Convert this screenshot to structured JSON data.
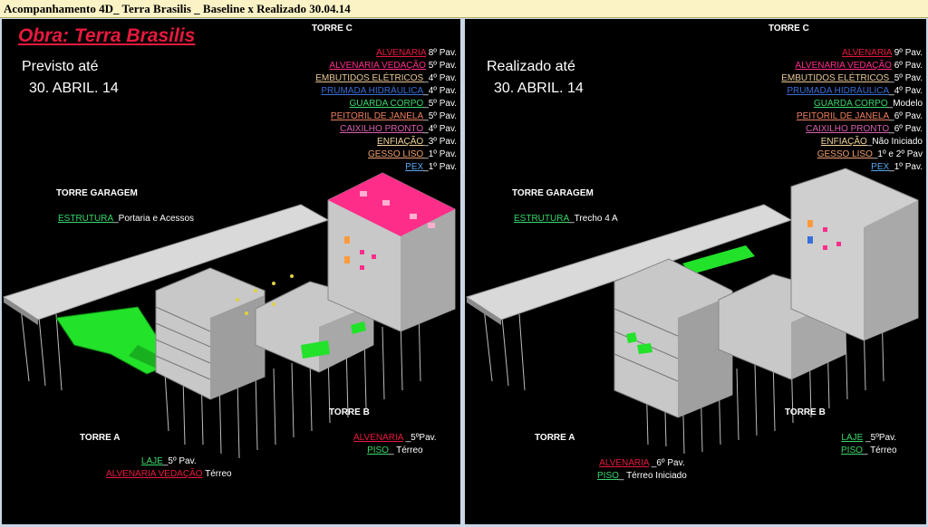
{
  "title": "Acompanhamento 4D_ Terra Brasilis _ Baseline x Realizado 30.04.14",
  "colors": {
    "red": "#e8193e",
    "magenta": "#ff2d8a",
    "blue": "#3a6fd8",
    "green": "#39d86a",
    "salmon": "#f08060",
    "pink": "#d95fb0",
    "cream": "#f2d49a",
    "peach": "#f0a070",
    "lightblue": "#58a8f0",
    "tan": "#e8c898",
    "white": "#ffffff"
  },
  "left": {
    "obra": "Obra: Terra Brasilis",
    "label_line1": "Previsto até",
    "label_line2": "30. ABRIL. 14",
    "torre_c": "TORRE C",
    "torre_garagem": "TORRE GARAGEM",
    "garagem_item": {
      "key": "ESTRUTURA",
      "value": "_Portaria e Acessos"
    },
    "torre_a": "TORRE A",
    "torre_b": "TORRE B",
    "torre_c_items": [
      {
        "key": "ALVENARIA",
        "value": "8º Pav.",
        "color": "red"
      },
      {
        "key": "ALVENARIA VEDAÇÃO",
        "value": "5º Pav.",
        "color": "magenta"
      },
      {
        "key": "EMBUTIDOS ELÉTRICOS",
        "value": "_4º Pav.",
        "color": "tan"
      },
      {
        "key": "PRUMADA HIDRÁULICA",
        "value": "_4º Pav.",
        "color": "blue"
      },
      {
        "key": "GUARDA CORPO",
        "value": "_5º Pav.",
        "color": "green"
      },
      {
        "key": "PEITORIL DE JANELA",
        "value": "_5º Pav.",
        "color": "salmon"
      },
      {
        "key": "CAIXILHO PRONTO",
        "value": "_4º Pav.",
        "color": "pink"
      },
      {
        "key": "ENFIAÇÃO",
        "value": "_3º Pav.",
        "color": "cream"
      },
      {
        "key": "GESSO LISO",
        "value": "_1º Pav.",
        "color": "peach"
      },
      {
        "key": "PEX",
        "value": "_1º Pav.",
        "color": "lightblue"
      }
    ],
    "torre_a_items": [
      {
        "key": "LAJE",
        "value": "_5º Pav.",
        "color": "green"
      },
      {
        "key": "ALVENARIA VEDAÇÃO",
        "value": " Térreo",
        "color": "red"
      }
    ],
    "torre_b_items": [
      {
        "key": "ALVENARIA",
        "value": " _5ºPav.",
        "color": "red"
      },
      {
        "key": "PISO",
        "value": "_ Térreo",
        "color": "green"
      }
    ]
  },
  "right": {
    "label_line1": "Realizado até",
    "label_line2": "30. ABRIL. 14",
    "torre_c": "TORRE C",
    "torre_garagem": "TORRE GARAGEM",
    "garagem_item": {
      "key": "ESTRUTURA",
      "value": "_Trecho  4 A"
    },
    "torre_a": "TORRE A",
    "torre_b": "TORRE B",
    "torre_c_items": [
      {
        "key": "ALVENARIA",
        "value": "9º Pav.",
        "color": "red"
      },
      {
        "key": "ALVENARIA VEDAÇÃO",
        "value": "6º Pav.",
        "color": "magenta"
      },
      {
        "key": "EMBUTIDOS ELÉTRICOS",
        "value": "_5º Pav.",
        "color": "tan"
      },
      {
        "key": "PRUMADA HIDRÁULICA",
        "value": "_4º Pav.",
        "color": "blue"
      },
      {
        "key": "GUARDA CORPO",
        "value": "_Modelo",
        "color": "green"
      },
      {
        "key": "PEITORIL DE JANELA",
        "value": "_6º Pav.",
        "color": "salmon"
      },
      {
        "key": "CAIXILHO PRONTO",
        "value": "_6º Pav.",
        "color": "pink"
      },
      {
        "key": "ENFIAÇÃO",
        "value": "_Não Iniciado",
        "color": "cream"
      },
      {
        "key": "GESSO LISO",
        "value": "_1º  e 2º Pav",
        "color": "peach"
      },
      {
        "key": "PEX",
        "value": "_1º Pav.",
        "color": "lightblue"
      }
    ],
    "torre_a_items": [
      {
        "key": "ALVENARIA",
        "value": " _6º Pav.",
        "color": "red"
      },
      {
        "key": "PISO",
        "value": "_ Térreo Iniciado",
        "color": "green"
      }
    ],
    "torre_b_items": [
      {
        "key": "LAJE",
        "value": " _5ºPav.",
        "color": "green"
      },
      {
        "key": "PISO",
        "value": "_ Térreo",
        "color": "green"
      }
    ]
  }
}
